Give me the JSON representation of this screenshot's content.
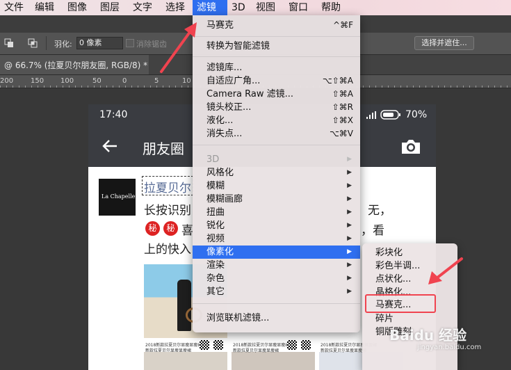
{
  "menubar": {
    "items": [
      "文件",
      "编辑",
      "图像",
      "图层",
      "文字",
      "选择",
      "滤镜",
      "3D",
      "视图",
      "窗口",
      "帮助"
    ],
    "active_index": 6
  },
  "options_bar": {
    "feather_label": "羽化:",
    "feather_value": "0 像素",
    "antialias_label": "消除锯齿",
    "select_mask_button": "选择并遮住..."
  },
  "document": {
    "tab_title": "@ 66.7% (拉夏贝尔朋友圈, RGB/8) *"
  },
  "ruler": {
    "ticks": [
      "200",
      "150",
      "100",
      "50",
      "0",
      "5",
      "10"
    ]
  },
  "phone": {
    "time": "17:40",
    "battery": "70%",
    "nav_title": "朋友圈",
    "post": {
      "logo_text": "La Chapelle",
      "author": "拉夏贝尔",
      "line1": "长按识别",
      "line1_tail": "无，",
      "badge": "秘",
      "line2_fragment": "喜",
      "line2_tail": "，看",
      "line3": "上的快入",
      "thumb_caption": "2018新款拉夏贝尔显瘦显瘦裙",
      "thumb_caption2": "新款拉夏贝尔显瘦显瘦裙"
    }
  },
  "filter_menu": {
    "items": [
      {
        "label": "马赛克",
        "shortcut": "^⌘F"
      },
      {
        "label": "转换为智能滤镜"
      },
      {
        "label": "滤镜库..."
      },
      {
        "label": "自适应广角...",
        "shortcut": "⌥⇧⌘A"
      },
      {
        "label": "Camera Raw 滤镜...",
        "shortcut": "⇧⌘A"
      },
      {
        "label": "镜头校正...",
        "shortcut": "⇧⌘R"
      },
      {
        "label": "液化...",
        "shortcut": "⇧⌘X"
      },
      {
        "label": "消失点...",
        "shortcut": "⌥⌘V"
      },
      {
        "label": "3D",
        "disabled": true
      },
      {
        "label": "风格化"
      },
      {
        "label": "模糊"
      },
      {
        "label": "模糊画廊"
      },
      {
        "label": "扭曲"
      },
      {
        "label": "锐化"
      },
      {
        "label": "视频"
      },
      {
        "label": "像素化",
        "highlighted": true
      },
      {
        "label": "渲染"
      },
      {
        "label": "杂色"
      },
      {
        "label": "其它"
      },
      {
        "label": "浏览联机滤镜..."
      }
    ]
  },
  "pixelate_submenu": {
    "items": [
      "彩块化",
      "彩色半调...",
      "点状化...",
      "晶格化...",
      "马赛克...",
      "碎片",
      "铜版雕刻"
    ],
    "boxed_index": 4
  },
  "watermark": {
    "text": "Baidu 经验",
    "sub": "jingyan.baidu.com"
  },
  "colors": {
    "menu_highlight": "#2f6ff0",
    "annotation": "#f0434f",
    "phone_bar": "#3a3c41"
  }
}
